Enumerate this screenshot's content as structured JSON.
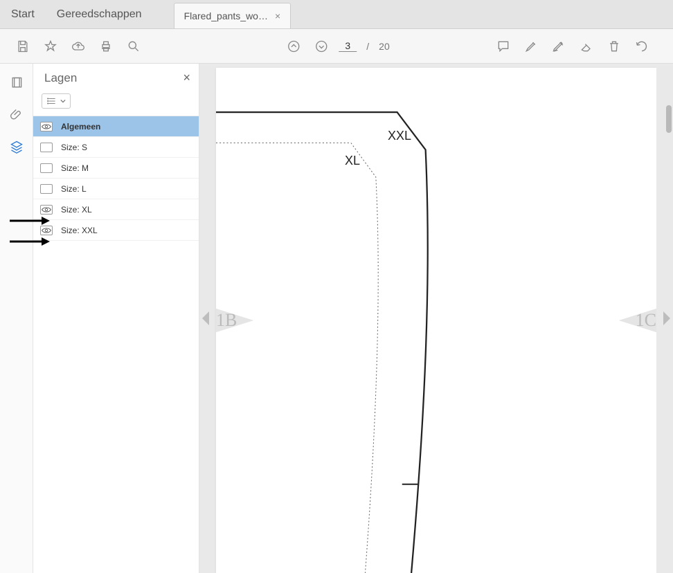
{
  "tabs": {
    "start": "Start",
    "tools": "Gereedschappen",
    "doc_title": "Flared_pants_wo…"
  },
  "toolbar": {
    "page_current": "3",
    "page_total": "20",
    "page_sep": "/"
  },
  "sidepanel": {
    "title": "Lagen"
  },
  "layers": [
    {
      "label": "Algemeen",
      "visible": true,
      "selected": true
    },
    {
      "label": "Size: S",
      "visible": false,
      "selected": false
    },
    {
      "label": "Size: M",
      "visible": false,
      "selected": false
    },
    {
      "label": "Size: L",
      "visible": false,
      "selected": false
    },
    {
      "label": "Size: XL",
      "visible": true,
      "selected": false
    },
    {
      "label": "Size: XXL",
      "visible": true,
      "selected": false
    }
  ],
  "pattern": {
    "label_xxl": "XXL",
    "label_xl": "XL",
    "marker_left": "1B",
    "marker_right": "1C"
  }
}
